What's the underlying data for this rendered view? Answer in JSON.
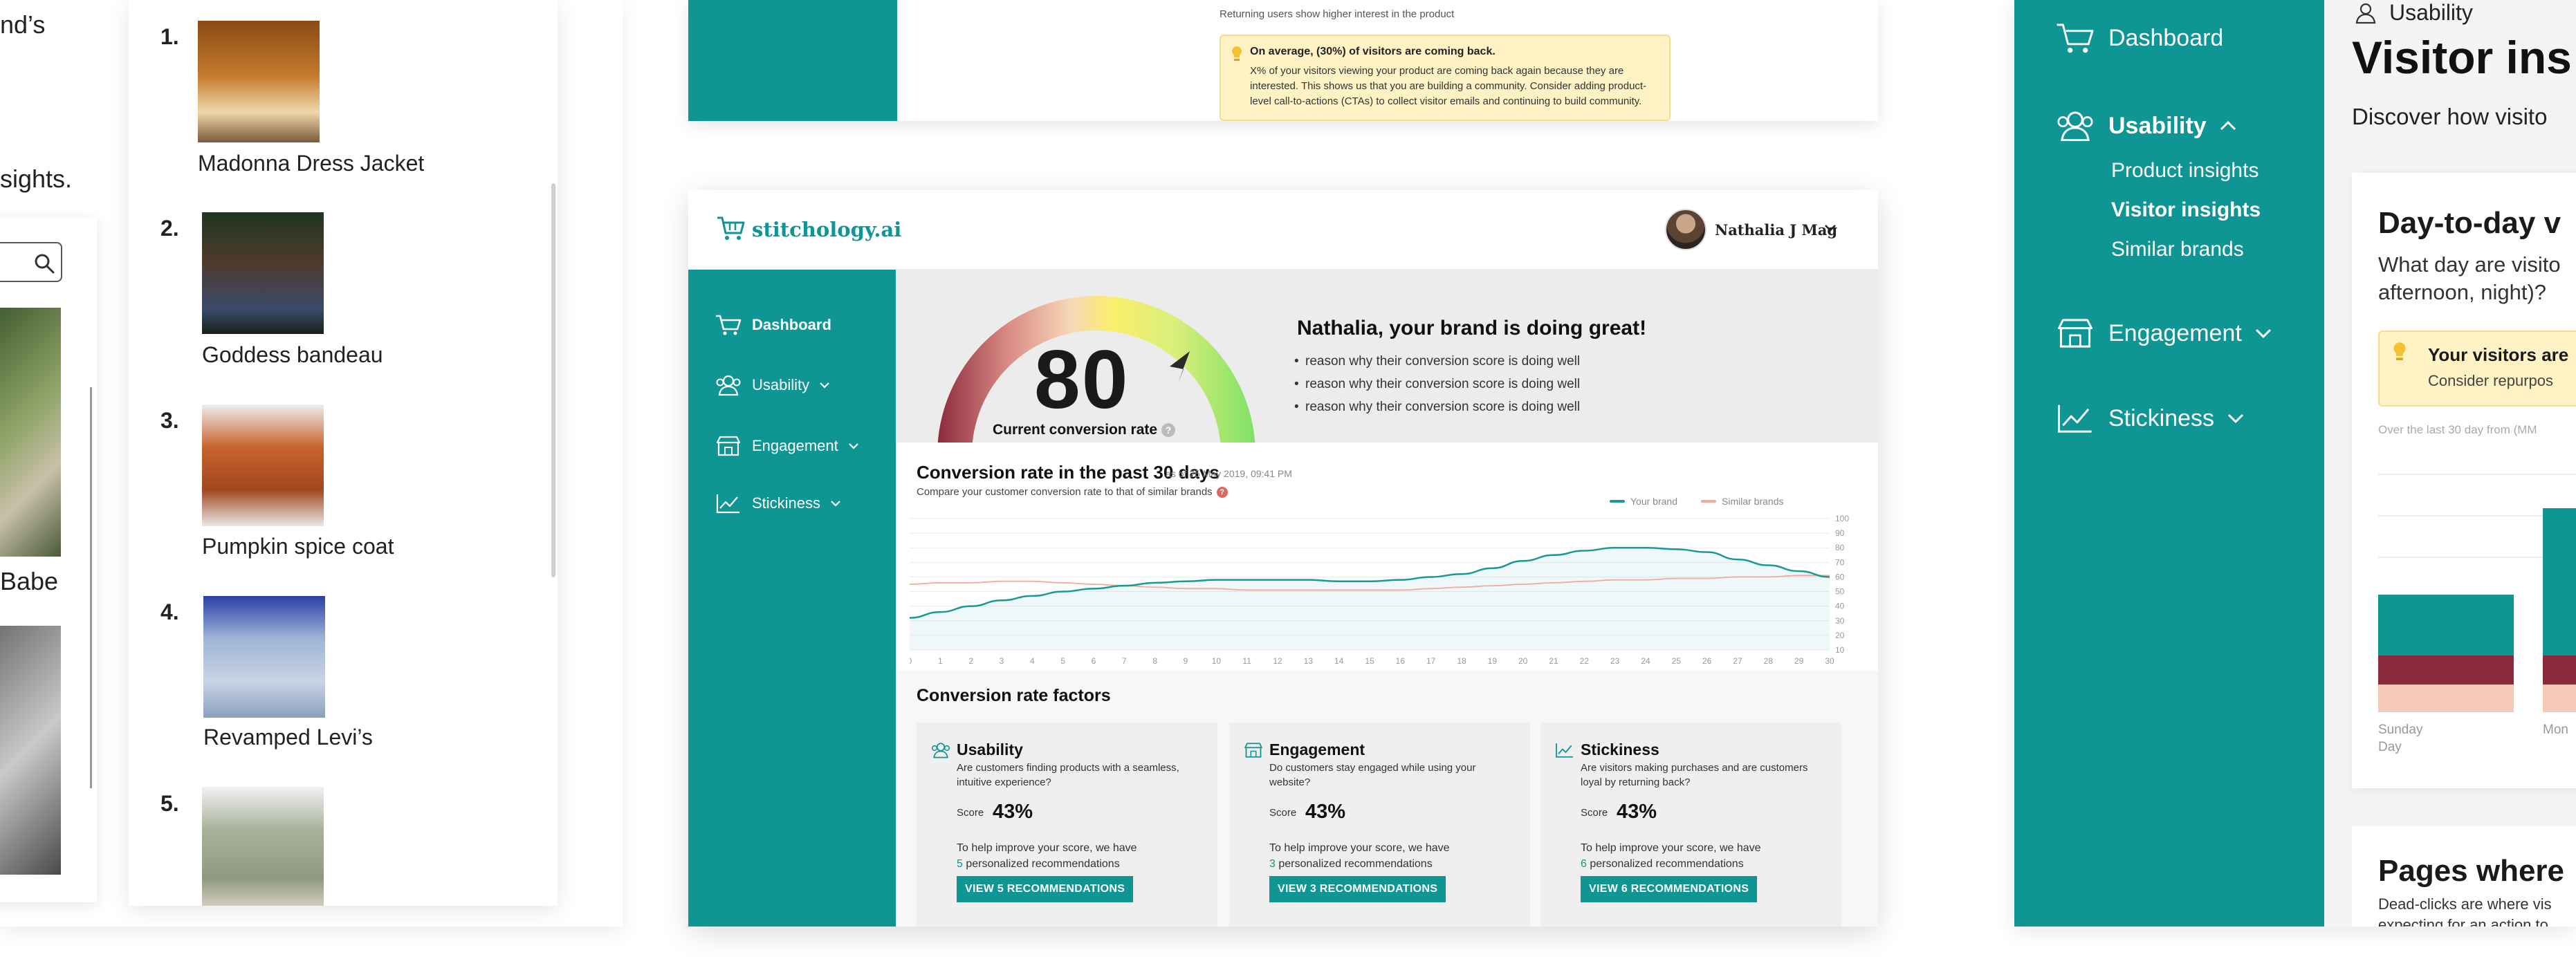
{
  "left_page": {
    "fragment_top": "nd’s",
    "fragment_mid": "sights.",
    "fragment_label": "Babe",
    "products": [
      {
        "num": "1.",
        "name": "Madonna Dress Jacket"
      },
      {
        "num": "2.",
        "name": "Goddess bandeau"
      },
      {
        "num": "3.",
        "name": "Pumpkin spice coat"
      },
      {
        "num": "4.",
        "name": "Revamped Levi’s"
      },
      {
        "num": "5.",
        "name": ""
      }
    ]
  },
  "mid_top": {
    "note": "Returning users show higher interest in the product",
    "tip_title": "On average, (30%) of visitors are coming back.",
    "tip_body": "X% of your visitors viewing your product are coming back again because they are interested. This shows us that you are building a community. Consider adding product-level call-to-actions (CTAs) to collect visitor emails and continuing to build community."
  },
  "dashboard": {
    "brand": "stitchology.ai",
    "user_name": "Nathalia J Mag",
    "nav": [
      {
        "label": "Dashboard",
        "icon": "cart-icon"
      },
      {
        "label": "Usability",
        "icon": "users-icon"
      },
      {
        "label": "Engagement",
        "icon": "store-icon"
      },
      {
        "label": "Stickiness",
        "icon": "trend-icon"
      }
    ],
    "score": "80",
    "score_label": "Current conversion rate",
    "help_mark": "?",
    "great_title": "Nathalia, your brand is doing great!",
    "reasons": [
      "reason why their conversion score is doing well",
      "reason why their conversion score is doing well",
      "reason why their conversion score is doing well"
    ],
    "chart_title": "Conversion rate in the past 30 days",
    "chart_asof": "as of 25 May 2019, 09:41 PM",
    "chart_sub": "Compare your customer conversion rate to that of similar brands",
    "factors_title": "Conversion rate factors",
    "factors": [
      {
        "title": "Usability",
        "desc": "Are customers finding products with a seamless, intuitive experience?",
        "score_label": "Score",
        "score": "43%",
        "help_a": "To help improve your score, we have",
        "count": "5",
        "help_b": "personalized recommendations",
        "button": "VIEW 5 RECOMMENDATIONS"
      },
      {
        "title": "Engagement",
        "desc": "Do customers stay engaged while using your website?",
        "score_label": "Score",
        "score": "43%",
        "help_a": "To help improve your score, we have",
        "count": "3",
        "help_b": "personalized recommendations",
        "button": "VIEW 3 RECOMMENDATIONS"
      },
      {
        "title": "Stickiness",
        "desc": "Are visitors making purchases and are customers loyal by returning back?",
        "score_label": "Score",
        "score": "43%",
        "help_a": "To help improve your score, we have",
        "count": "6",
        "help_b": "personalized recommendations",
        "button": "VIEW 6 RECOMMENDATIONS"
      }
    ]
  },
  "chart_data": {
    "type": "line",
    "x": [
      0,
      1,
      2,
      3,
      4,
      5,
      6,
      7,
      8,
      9,
      10,
      11,
      12,
      13,
      14,
      15,
      16,
      17,
      18,
      19,
      20,
      21,
      22,
      23,
      24,
      25,
      26,
      27,
      28,
      29,
      30
    ],
    "series": [
      {
        "name": "Your brand",
        "color": "#1a9896",
        "values": [
          32,
          36,
          40,
          44,
          47,
          50,
          52,
          54,
          56,
          57,
          58,
          58,
          58,
          58,
          57,
          57,
          58,
          60,
          62,
          66,
          71,
          75,
          78,
          80,
          80,
          79,
          77,
          72,
          68,
          64,
          60
        ]
      },
      {
        "name": "Similar brands",
        "color": "#f2aa9a",
        "values": [
          55,
          56,
          56,
          57,
          57,
          56,
          55,
          54,
          53,
          52,
          52,
          51,
          51,
          51,
          51,
          51,
          51,
          52,
          53,
          54,
          55,
          56,
          57,
          58,
          58,
          59,
          59,
          60,
          60,
          61,
          61
        ]
      }
    ],
    "ylim": [
      10,
      100
    ],
    "yticks": [
      10,
      20,
      30,
      40,
      50,
      60,
      70,
      80,
      90,
      100
    ],
    "grid": true,
    "legend": "top-right"
  },
  "right_page": {
    "crumb": "Usability",
    "title": "Visitor ins",
    "desc": "Discover how visito",
    "nav": {
      "dashboard": "Dashboard",
      "usability": "Usability",
      "engagement": "Engagement",
      "stickiness": "Stickiness"
    },
    "sub": [
      "Product insights",
      "Visitor insights",
      "Similar brands"
    ],
    "card_title": "Day-to-day v",
    "card_q1": "What day are visito",
    "card_q2": "afternoon, night)?",
    "tip_title": "Your visitors are",
    "tip_body": "Consider repurpos",
    "caption": "Over the last 30 day from (MM",
    "bar_label_a1": "Sunday",
    "bar_label_a2": "Day",
    "bar_label_b": "Mon",
    "pages_title": "Pages where",
    "pages_body_1": "Dead-clicks are where vis",
    "pages_body_2": "expecting for an action to"
  },
  "colors": {
    "teal": "#0e9594",
    "maroon": "#8c2a3c",
    "peach": "#f5c9b5",
    "yellow_tip": "#fff3c6"
  }
}
